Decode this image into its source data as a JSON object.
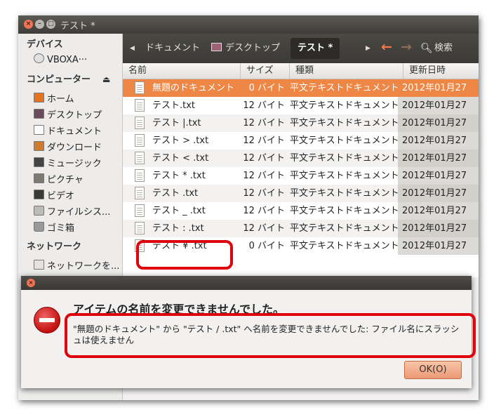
{
  "window": {
    "title": "テスト *"
  },
  "sidebar": {
    "devices_header": "デバイス",
    "device_item": "VBOXA···",
    "computer_header": "コンピューター",
    "places": [
      {
        "label": "ホーム",
        "icon": "home-folder-icon"
      },
      {
        "label": "デスクトップ",
        "icon": "desktop-icon"
      },
      {
        "label": "ドキュメント",
        "icon": "documents-folder-icon"
      },
      {
        "label": "ダウンロード",
        "icon": "downloads-folder-icon"
      },
      {
        "label": "ミュージック",
        "icon": "music-folder-icon"
      },
      {
        "label": "ピクチャ",
        "icon": "pictures-folder-icon"
      },
      {
        "label": "ビデオ",
        "icon": "videos-folder-icon"
      },
      {
        "label": "ファイルシス...",
        "icon": "filesystem-icon"
      },
      {
        "label": "ゴミ箱",
        "icon": "trash-icon"
      }
    ],
    "network_header": "ネットワーク",
    "network_item": "ネットワークを..."
  },
  "pathbar": {
    "documents": "ドキュメント",
    "desktop": "デスクトップ",
    "current": "テスト *",
    "search": "検索"
  },
  "columns": {
    "name": "名前",
    "size": "サイズ",
    "kind": "種類",
    "modified": "更新日時"
  },
  "files": [
    {
      "name": "無題のドキュメント",
      "size": "0 バイト",
      "kind": "平文テキストドキュメント",
      "modified": "2012年01月27"
    },
    {
      "name": "テスト.txt",
      "size": "12 バイト",
      "kind": "平文テキストドキュメント",
      "modified": "2012年01月27"
    },
    {
      "name": "テスト |.txt",
      "size": "12 バイト",
      "kind": "平文テキストドキュメント",
      "modified": "2012年01月27"
    },
    {
      "name": "テスト > .txt",
      "size": "12 バイト",
      "kind": "平文テキストドキュメント",
      "modified": "2012年01月27"
    },
    {
      "name": "テスト < .txt",
      "size": "12 バイト",
      "kind": "平文テキストドキュメント",
      "modified": "2012年01月27"
    },
    {
      "name": "テスト * .txt",
      "size": "12 バイト",
      "kind": "平文テキストドキュメント",
      "modified": "2012年01月27"
    },
    {
      "name": "テスト  .txt",
      "size": "12 バイト",
      "kind": "平文テキストドキュメント",
      "modified": "2012年01月27"
    },
    {
      "name": "テスト _ .txt",
      "size": "12 バイト",
      "kind": "平文テキストドキュメント",
      "modified": "2012年01月27"
    },
    {
      "name": "テスト : .txt",
      "size": "12 バイト",
      "kind": "平文テキストドキュメント",
      "modified": "2012年01月27"
    },
    {
      "name": "テスト ¥ .txt",
      "size": "0 バイト",
      "kind": "平文テキストドキュメント",
      "modified": "2012年01月27"
    }
  ],
  "dialog": {
    "heading": "アイテムの名前を変更できませんでした。",
    "message": "\"無題のドキュメント\" から \"テスト / .txt\" へ名前を変更できませんでした: ファイル名にスラッシュは使えません",
    "ok_label": "OK(O)"
  },
  "colors": {
    "accent": "#ee8646",
    "callout": "#e0000c",
    "titlebar": "#3d3c38"
  }
}
